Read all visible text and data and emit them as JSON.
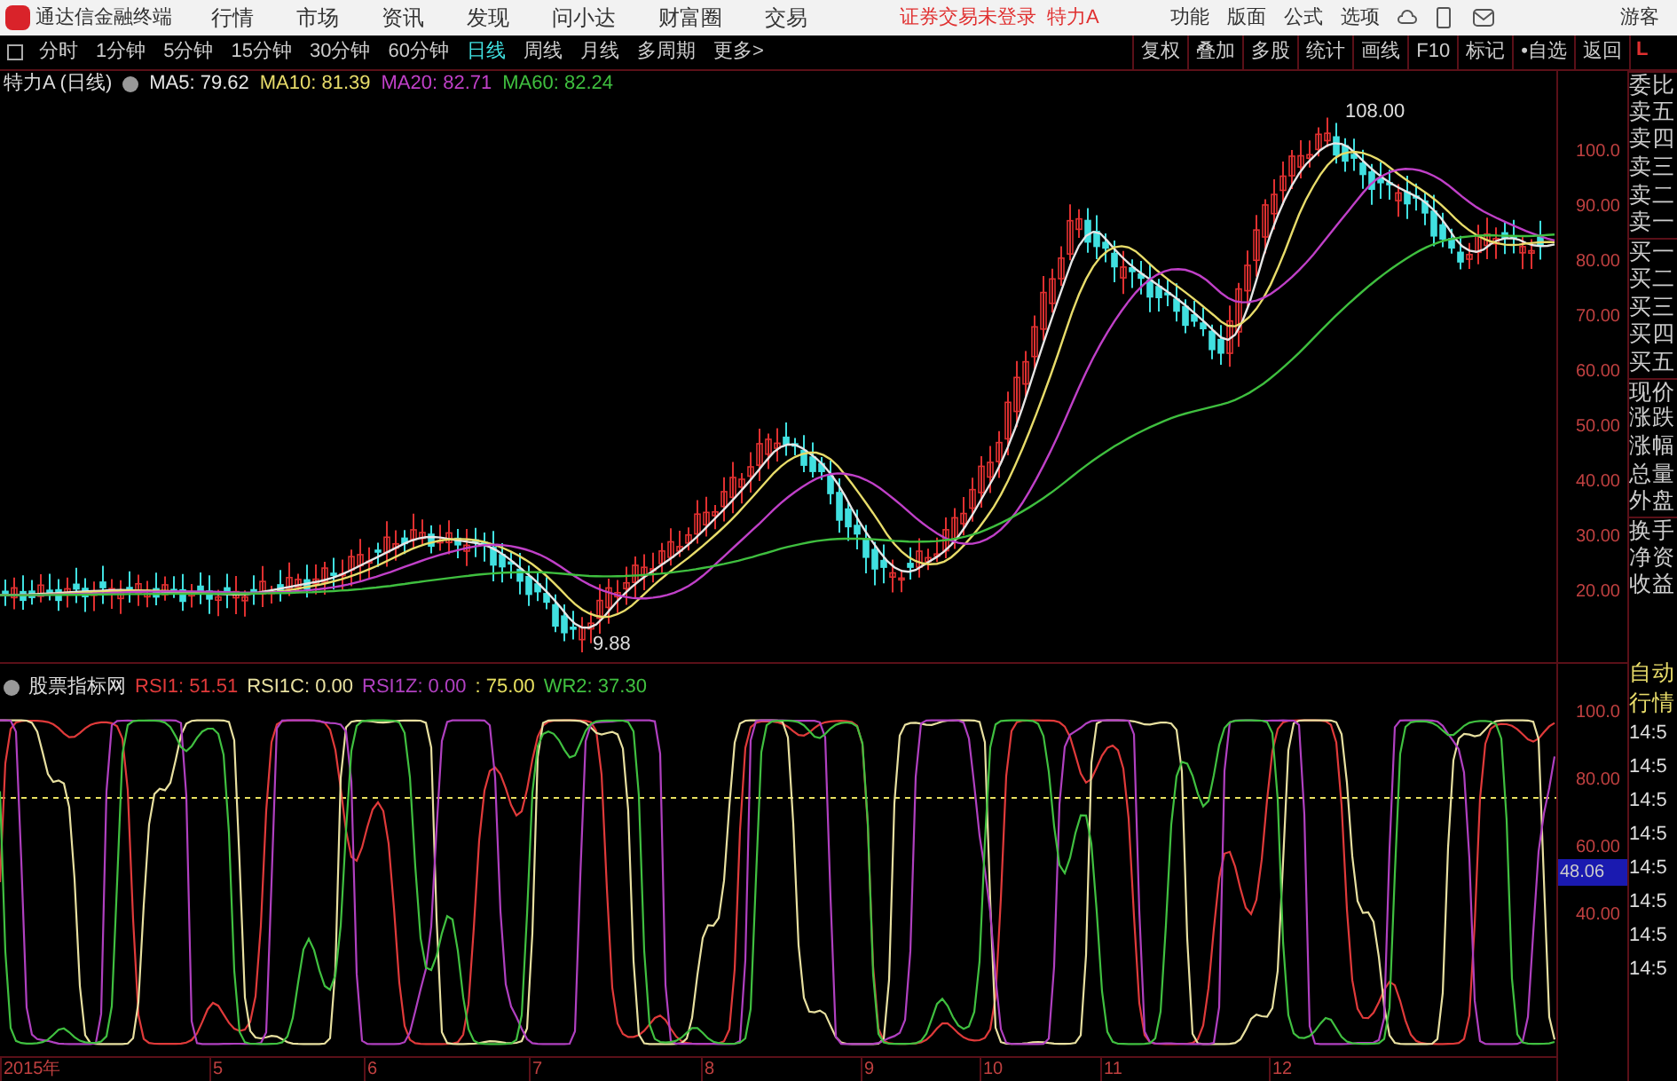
{
  "title_bar": {
    "app_name": "通达信金融终端",
    "menu": [
      "行情",
      "市场",
      "资讯",
      "发现",
      "问小达",
      "财富圈",
      "交易"
    ],
    "login_status": "证券交易未登录",
    "stock_name": "特力A",
    "tools": [
      "功能",
      "版面",
      "公式",
      "选项"
    ],
    "user": "游客"
  },
  "toolbar": {
    "periods": [
      {
        "label": "分时",
        "selected": false
      },
      {
        "label": "1分钟",
        "selected": false
      },
      {
        "label": "5分钟",
        "selected": false
      },
      {
        "label": "15分钟",
        "selected": false
      },
      {
        "label": "30分钟",
        "selected": false
      },
      {
        "label": "60分钟",
        "selected": false
      },
      {
        "label": "日线",
        "selected": true
      },
      {
        "label": "周线",
        "selected": false
      },
      {
        "label": "月线",
        "selected": false
      },
      {
        "label": "多周期",
        "selected": false
      },
      {
        "label": "更多>",
        "selected": false
      }
    ],
    "buttons": [
      "复权",
      "叠加",
      "多股",
      "统计",
      "画线",
      "F10",
      "标记",
      "•自选",
      "返回"
    ],
    "corner": "L"
  },
  "price_chart": {
    "title": "特力A (日线)",
    "legend": [
      {
        "label": "MA5: 79.62",
        "color": "#e6e6e6"
      },
      {
        "label": "MA10: 81.39",
        "color": "#e8dc6a"
      },
      {
        "label": "MA20: 82.71",
        "color": "#c040c8"
      },
      {
        "label": "MA60: 82.24",
        "color": "#3fbf3f"
      }
    ],
    "high_label": "108.00",
    "low_label": "9.88",
    "axis": [
      "100.0",
      "90.00",
      "80.00",
      "70.00",
      "60.00",
      "50.00",
      "40.00",
      "30.00",
      "20.00"
    ]
  },
  "indicator": {
    "title": "股票指标网",
    "legend": [
      {
        "label": "RSI1: 51.51",
        "color": "#e03a3a",
        "kind": "line"
      },
      {
        "label": "RSI1C: 0.00",
        "color": "#e8e0a0",
        "kind": "line"
      },
      {
        "label": "RSI1Z: 0.00",
        "color": "#b040c0",
        "kind": "line"
      },
      {
        "label": ": 75.00",
        "color": "#e8e060",
        "kind": "level"
      },
      {
        "label": "WR2: 37.30",
        "color": "#40c040",
        "kind": "line"
      }
    ],
    "axis": [
      "100.0",
      "80.00",
      "60.00",
      "40.00"
    ],
    "current_value": "48.06"
  },
  "date_axis": [
    "2015年",
    "5",
    "6",
    "7",
    "8",
    "9",
    "10",
    "11",
    "12"
  ],
  "quote_panel": {
    "labels": [
      "委比",
      "卖五",
      "卖四",
      "卖三",
      "卖二",
      "卖一",
      "买一",
      "买二",
      "买三",
      "买四",
      "买五",
      "现价",
      "涨跌",
      "涨幅",
      "总量",
      "外盘",
      "换手",
      "净资",
      "收益"
    ],
    "mode": [
      "自动",
      "行情"
    ],
    "times": [
      "14:5",
      "14:5",
      "14:5",
      "14:5",
      "14:5",
      "14:5",
      "14:5",
      "14:5"
    ]
  }
}
